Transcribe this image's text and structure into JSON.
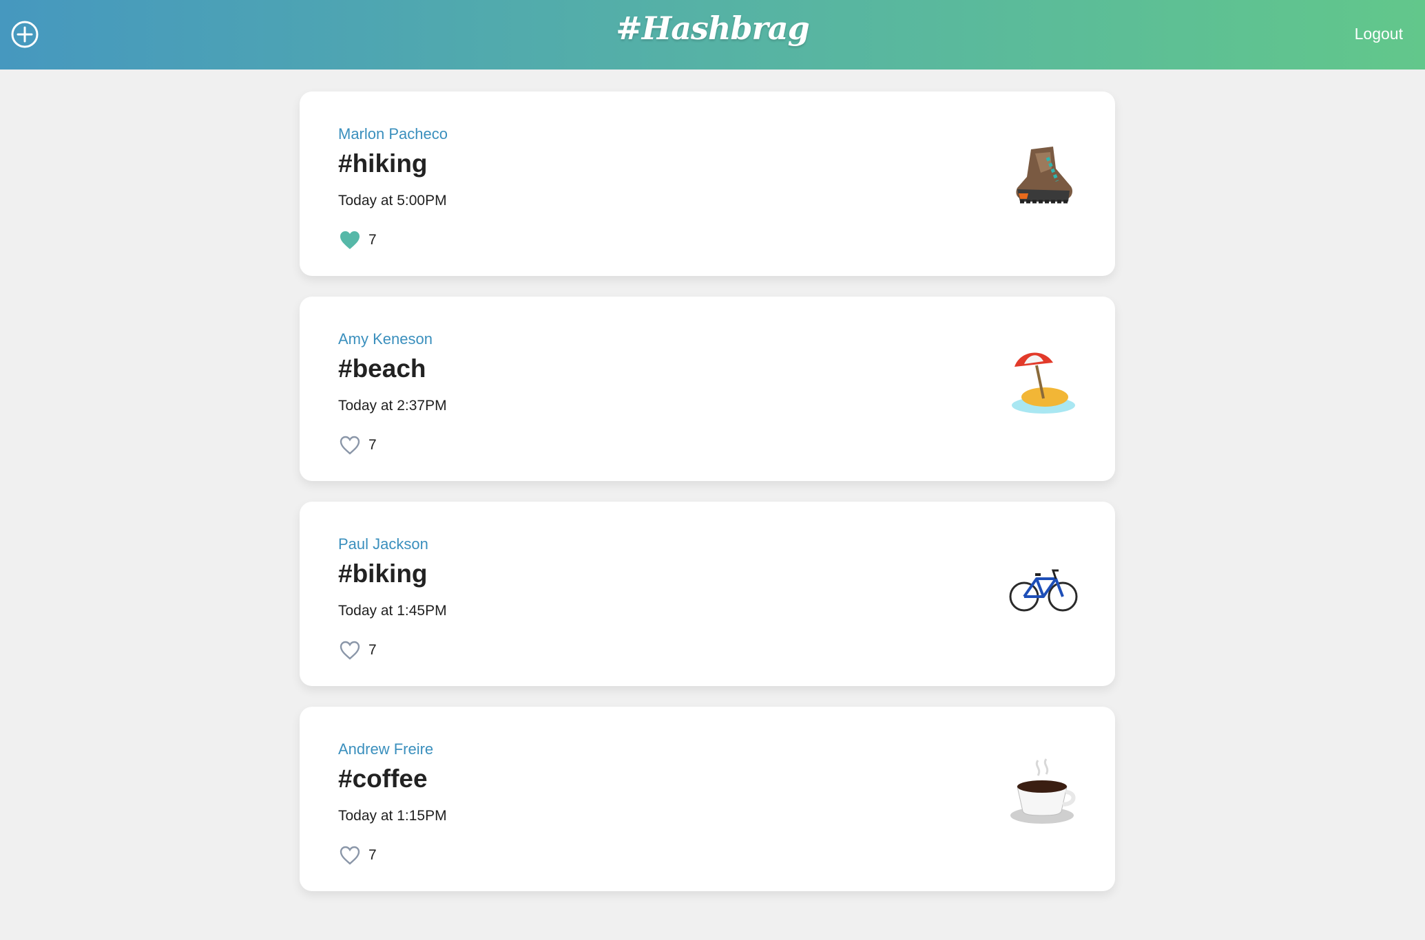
{
  "header": {
    "brand": "#Hashbrag",
    "logout_label": "Logout",
    "add_icon": "plus-circle-icon",
    "gradient": [
      "#4698bf",
      "#62c78b"
    ]
  },
  "posts": [
    {
      "author": "Marlon Pacheco",
      "tag": "#hiking",
      "time": "Today at 5:00PM",
      "likes": "7",
      "liked": true,
      "icon": "hiking-boot-icon"
    },
    {
      "author": "Amy Keneson",
      "tag": "#beach",
      "time": "Today at 2:37PM",
      "likes": "7",
      "liked": false,
      "icon": "beach-umbrella-icon"
    },
    {
      "author": "Paul Jackson",
      "tag": "#biking",
      "time": "Today at 1:45PM",
      "likes": "7",
      "liked": false,
      "icon": "bicycle-icon"
    },
    {
      "author": "Andrew Freire",
      "tag": "#coffee",
      "time": "Today at 1:15PM",
      "likes": "7",
      "liked": false,
      "icon": "coffee-cup-icon"
    }
  ],
  "colors": {
    "accent": "#3a8fbd",
    "heart_filled": "#56b8a8",
    "heart_outline": "#8a96a8"
  }
}
